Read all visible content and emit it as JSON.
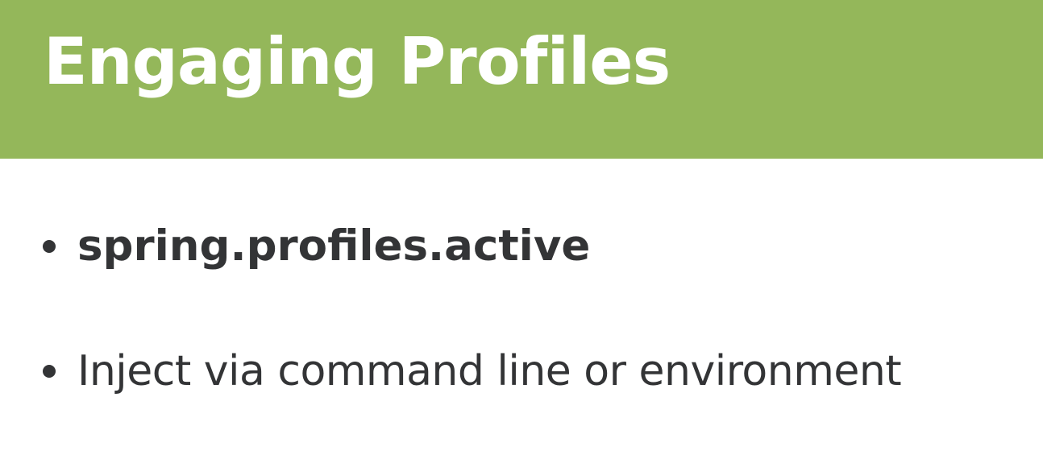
{
  "slide": {
    "title": "Engaging Profiles",
    "bullets": [
      {
        "text": "spring.profiles.active"
      },
      {
        "text": "Inject via command line or environment"
      }
    ]
  },
  "colors": {
    "title_bar": "#94b75a",
    "title_text": "#ffffff",
    "body_text": "#333436",
    "background": "#ffffff"
  }
}
